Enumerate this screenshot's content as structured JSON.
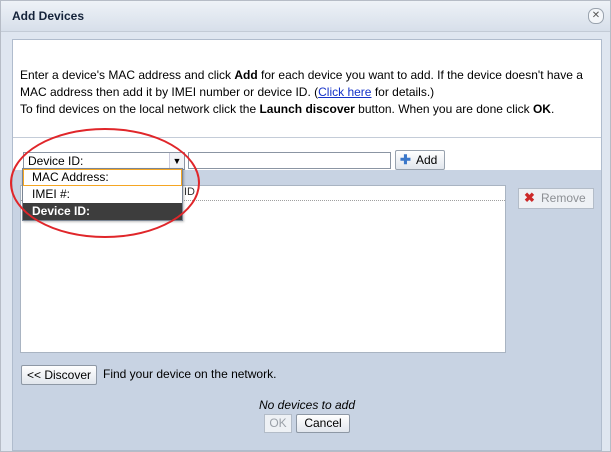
{
  "dialog": {
    "title": "Add Devices",
    "close_icon": "close-icon",
    "intro": {
      "part1": "Enter a device's MAC address and click ",
      "add_word": "Add",
      "part2": " for each device you want to add. If the device doesn't have a MAC address then add it by IMEI number or device ID. (",
      "link": "Click here",
      "part3": " for details.)",
      "line2a": "To find devices on the local network click the ",
      "launch_word": "Launch discover",
      "line2b": " button. When you are done click ",
      "ok_word": "OK",
      "line2c": "."
    },
    "id_type": {
      "selected": "Device ID:",
      "options": [
        "MAC Address:",
        "IMEI #:",
        "Device ID:"
      ]
    },
    "id_input": {
      "value": ""
    },
    "add_button": "Add",
    "list_header": {
      "col2": "ID"
    },
    "remove_button": "Remove",
    "discover_button": "<< Discover",
    "discover_hint": "Find your device on the network.",
    "empty_message": "No devices to add",
    "ok_button": "OK",
    "cancel_button": "Cancel"
  },
  "colors": {
    "annotation": "#e0262a",
    "link": "#1532c8",
    "selected_option_bg": "#3d3d3d"
  }
}
